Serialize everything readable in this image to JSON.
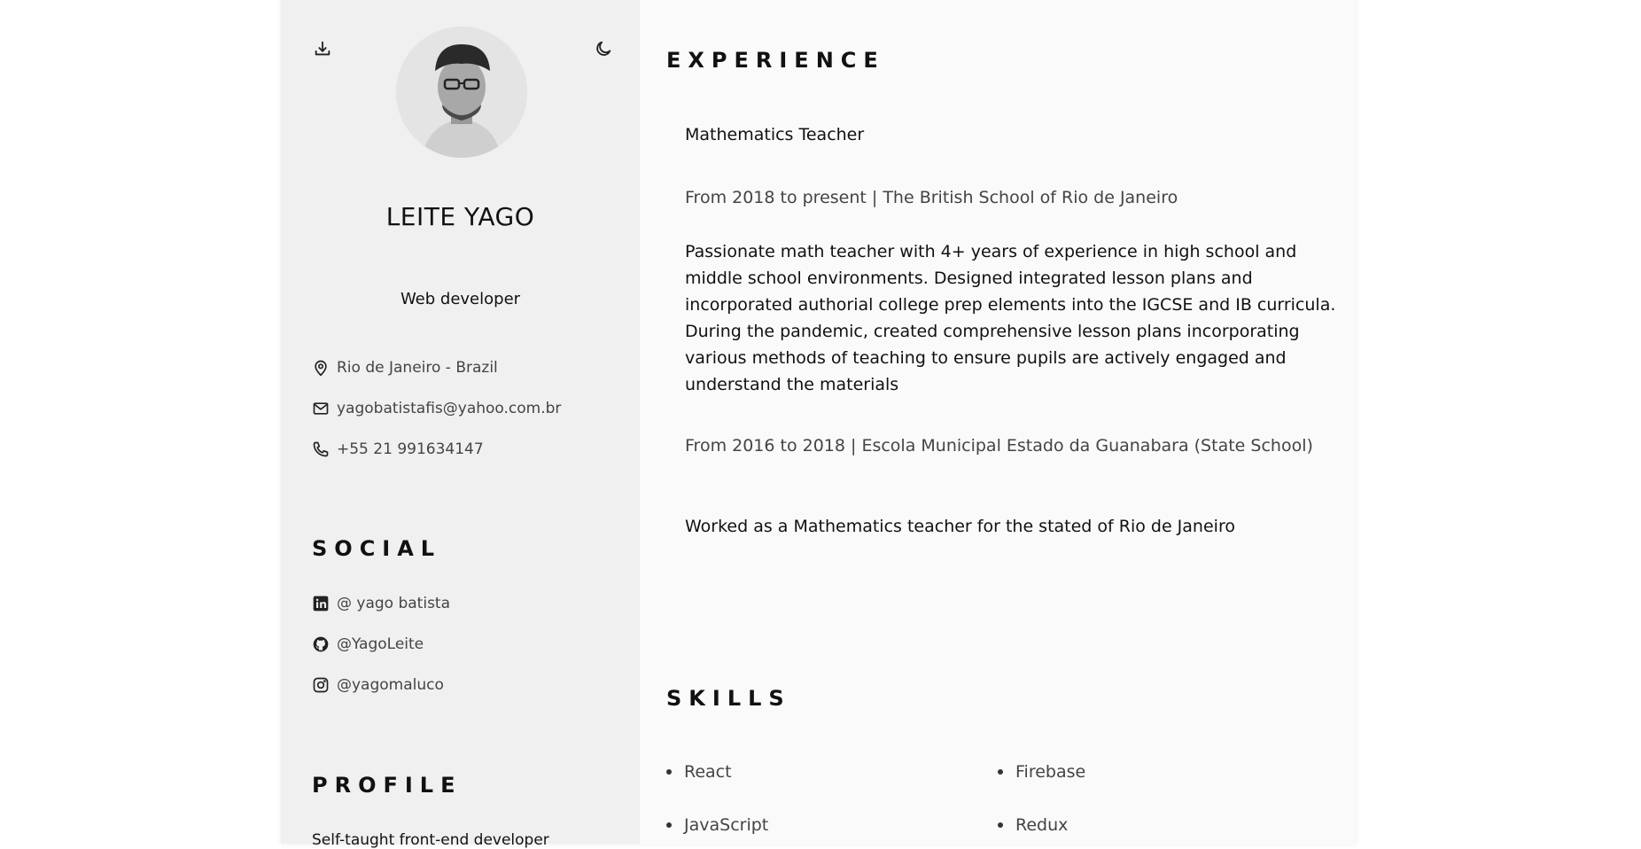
{
  "sidebar": {
    "download_icon": "download-icon",
    "theme_icon": "moon-icon",
    "avatar_alt": "Profile photo",
    "name": "LEITE YAGO",
    "role": "Web developer",
    "contact": {
      "location": "Rio de Janeiro - Brazil",
      "email": "yagobatistafis@yahoo.com.br",
      "phone": "+55 21 991634147"
    },
    "social_title": "SOCIAL",
    "social": {
      "linkedin": "@ yago batista",
      "github": "@YagoLeite",
      "instagram": "@yagomaluco"
    },
    "profile_title": "PROFILE",
    "profile_text": "Self-taught front-end developer"
  },
  "main": {
    "experience_title": "EXPERIENCE",
    "job_title": "Mathematics Teacher",
    "job1_meta": "From 2018 to present | The British School of Rio de Janeiro",
    "job1_desc": "Passionate math teacher with 4+ years of experience in high school and middle school environments. Designed integrated lesson plans and incorporated authorial college prep elements into the IGCSE and IB curricula. During the pandemic, created comprehensive lesson plans incorporating various methods of teaching to ensure pupils are actively engaged and understand the materials",
    "job2_meta": "From 2016 to 2018 | Escola Municipal Estado da Guanabara (State School)",
    "job2_desc": "Worked as a Mathematics teacher for the stated of Rio de Janeiro",
    "skills_title": "SKILLS",
    "skills": [
      "React",
      "Firebase",
      "JavaScript",
      "Redux"
    ]
  }
}
